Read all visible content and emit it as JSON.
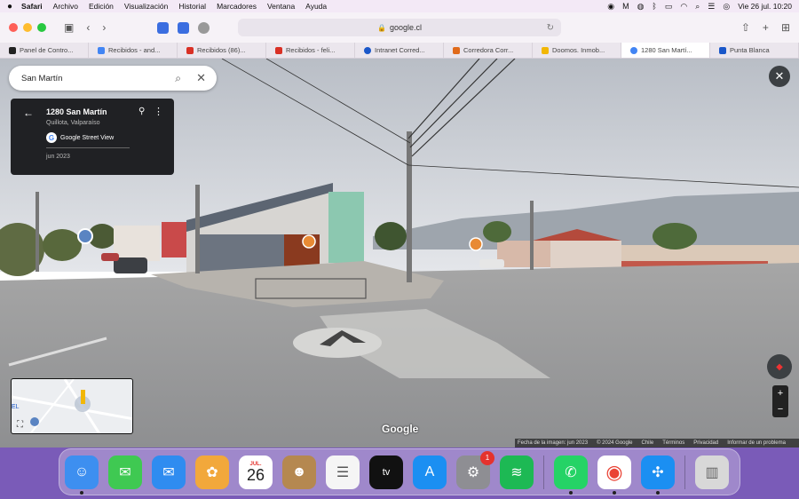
{
  "menubar": {
    "apple": "",
    "items": [
      "Safari",
      "Archivo",
      "Edición",
      "Visualización",
      "Historial",
      "Marcadores",
      "Ventana",
      "Ayuda"
    ],
    "datetime": "Vie 26 jul.  10:20"
  },
  "browser": {
    "address": "google.cl",
    "tabs": [
      {
        "label": "Panel de Contro...",
        "color": "#222222"
      },
      {
        "label": "Recibidos - and...",
        "color": "#4285f4"
      },
      {
        "label": "Recibidos (86)...",
        "color": "#d93025"
      },
      {
        "label": "Recibidos - feli...",
        "color": "#d93025"
      },
      {
        "label": "Intranet Corred...",
        "color": "#1a57c9"
      },
      {
        "label": "Corredora Corr...",
        "color": "#e06a1b"
      },
      {
        "label": "Doomos. Inmob...",
        "color": "#f2b705"
      },
      {
        "label": "1280 San Martí...",
        "color": "#4285f4"
      },
      {
        "label": "Punta Blanca",
        "color": "#1a57c9"
      }
    ]
  },
  "streetview": {
    "search_value": "San Martín",
    "card": {
      "title": "1280 San Martín",
      "subtitle": "Quillota, Valparaíso",
      "source": "Google Street View",
      "date": "jun 2023"
    },
    "minimap_label": "EL",
    "google_logo": "Google",
    "footer": [
      "Fecha de la imagen: jun 2023",
      "© 2024 Google",
      "Chile",
      "Términos",
      "Privacidad",
      "Informar de un problema"
    ],
    "zoom_in": "+",
    "zoom_out": "−"
  },
  "dock": {
    "apps": [
      {
        "name": "Finder",
        "glyph": "☺",
        "color": "#3d8ff0",
        "running": true
      },
      {
        "name": "Messages",
        "glyph": "💬",
        "color": "#3fc952",
        "running": false
      },
      {
        "name": "Mail",
        "glyph": "✉",
        "color": "#2f8cf0",
        "running": false
      },
      {
        "name": "Photos",
        "glyph": "✿",
        "color": "#f2a83b",
        "running": false
      },
      {
        "name": "Calendar",
        "glyph": "",
        "color": "#ffffff",
        "running": false,
        "month": "JUL.",
        "day": "26"
      },
      {
        "name": "Contacts",
        "glyph": "☻",
        "color": "#b58850",
        "running": false
      },
      {
        "name": "Reminders",
        "glyph": "☰",
        "color": "#f5f5f5",
        "running": false
      },
      {
        "name": "Apple TV",
        "glyph": "tv",
        "color": "#111111",
        "running": false
      },
      {
        "name": "App Store",
        "glyph": "A",
        "color": "#1b8ff2",
        "running": false
      },
      {
        "name": "System Settings",
        "glyph": "⚙",
        "color": "#8e8e93",
        "running": false,
        "badge": "1"
      },
      {
        "name": "Spotify",
        "glyph": "≋",
        "color": "#1db954",
        "running": false
      },
      {
        "name": "WhatsApp",
        "glyph": "✆",
        "color": "#25d366",
        "running": true
      },
      {
        "name": "Chrome",
        "glyph": "◉",
        "color": "#ea4335",
        "running": true
      },
      {
        "name": "Safari",
        "glyph": "✣",
        "color": "#1b8ff2",
        "running": true
      },
      {
        "name": "Trash",
        "glyph": "🗑",
        "color": "#d8d8d8",
        "running": false
      }
    ]
  }
}
